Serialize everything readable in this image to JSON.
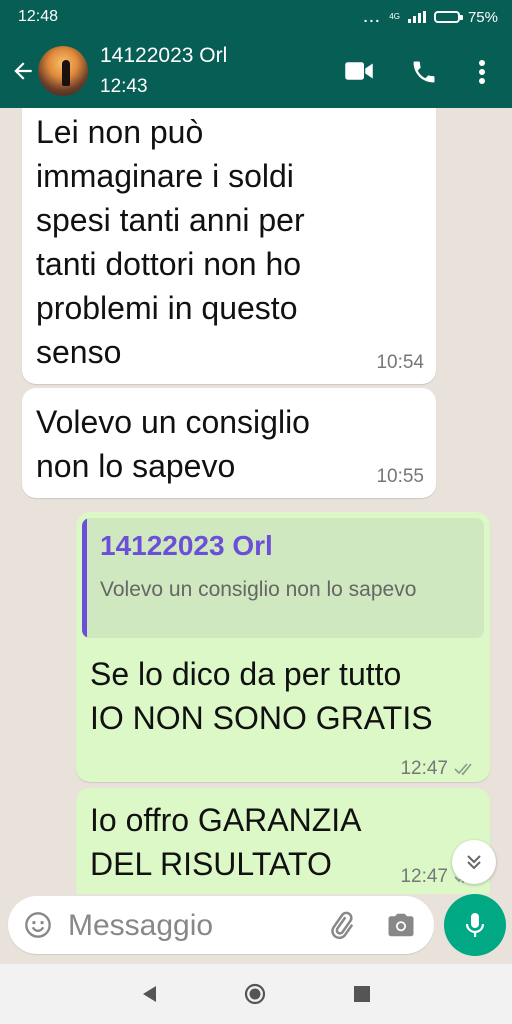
{
  "status_bar": {
    "time": "12:48",
    "dots": "...",
    "network": "4G",
    "battery": "75%",
    "battery_level": 0.75
  },
  "header": {
    "contact_name": "14122023 Orl",
    "contact_status": "12:43",
    "icons": [
      "back-arrow-icon",
      "video-call-icon",
      "phone-icon",
      "more-vert-icon"
    ]
  },
  "messages": [
    {
      "direction": "in",
      "text": "Lei non può\nimmaginare i soldi\nspesi tanti anni per\ntanti dottori non ho\nproblemi in questo\nsenso",
      "time": "10:54"
    },
    {
      "direction": "in",
      "text": "Volevo un consiglio\nnon lo sapevo",
      "time": "10:55"
    },
    {
      "direction": "out",
      "quote": {
        "author": "14122023 Orl",
        "text": "Volevo un consiglio non lo sapevo"
      },
      "text": "Se lo dico da per tutto\nIO NON SONO GRATIS",
      "time": "12:47",
      "status": "read"
    },
    {
      "direction": "out",
      "text": "Io offro GARANZIA\nDEL RISULTATO",
      "time": "12:47",
      "status": "read"
    }
  ],
  "input": {
    "placeholder": "Messaggio"
  },
  "colors": {
    "header": "#075E54",
    "outgoing_bubble": "#DCF8C6",
    "incoming_bubble": "#FFFFFF",
    "accent": "#00A884",
    "quote_author": "#6C4FD8"
  }
}
